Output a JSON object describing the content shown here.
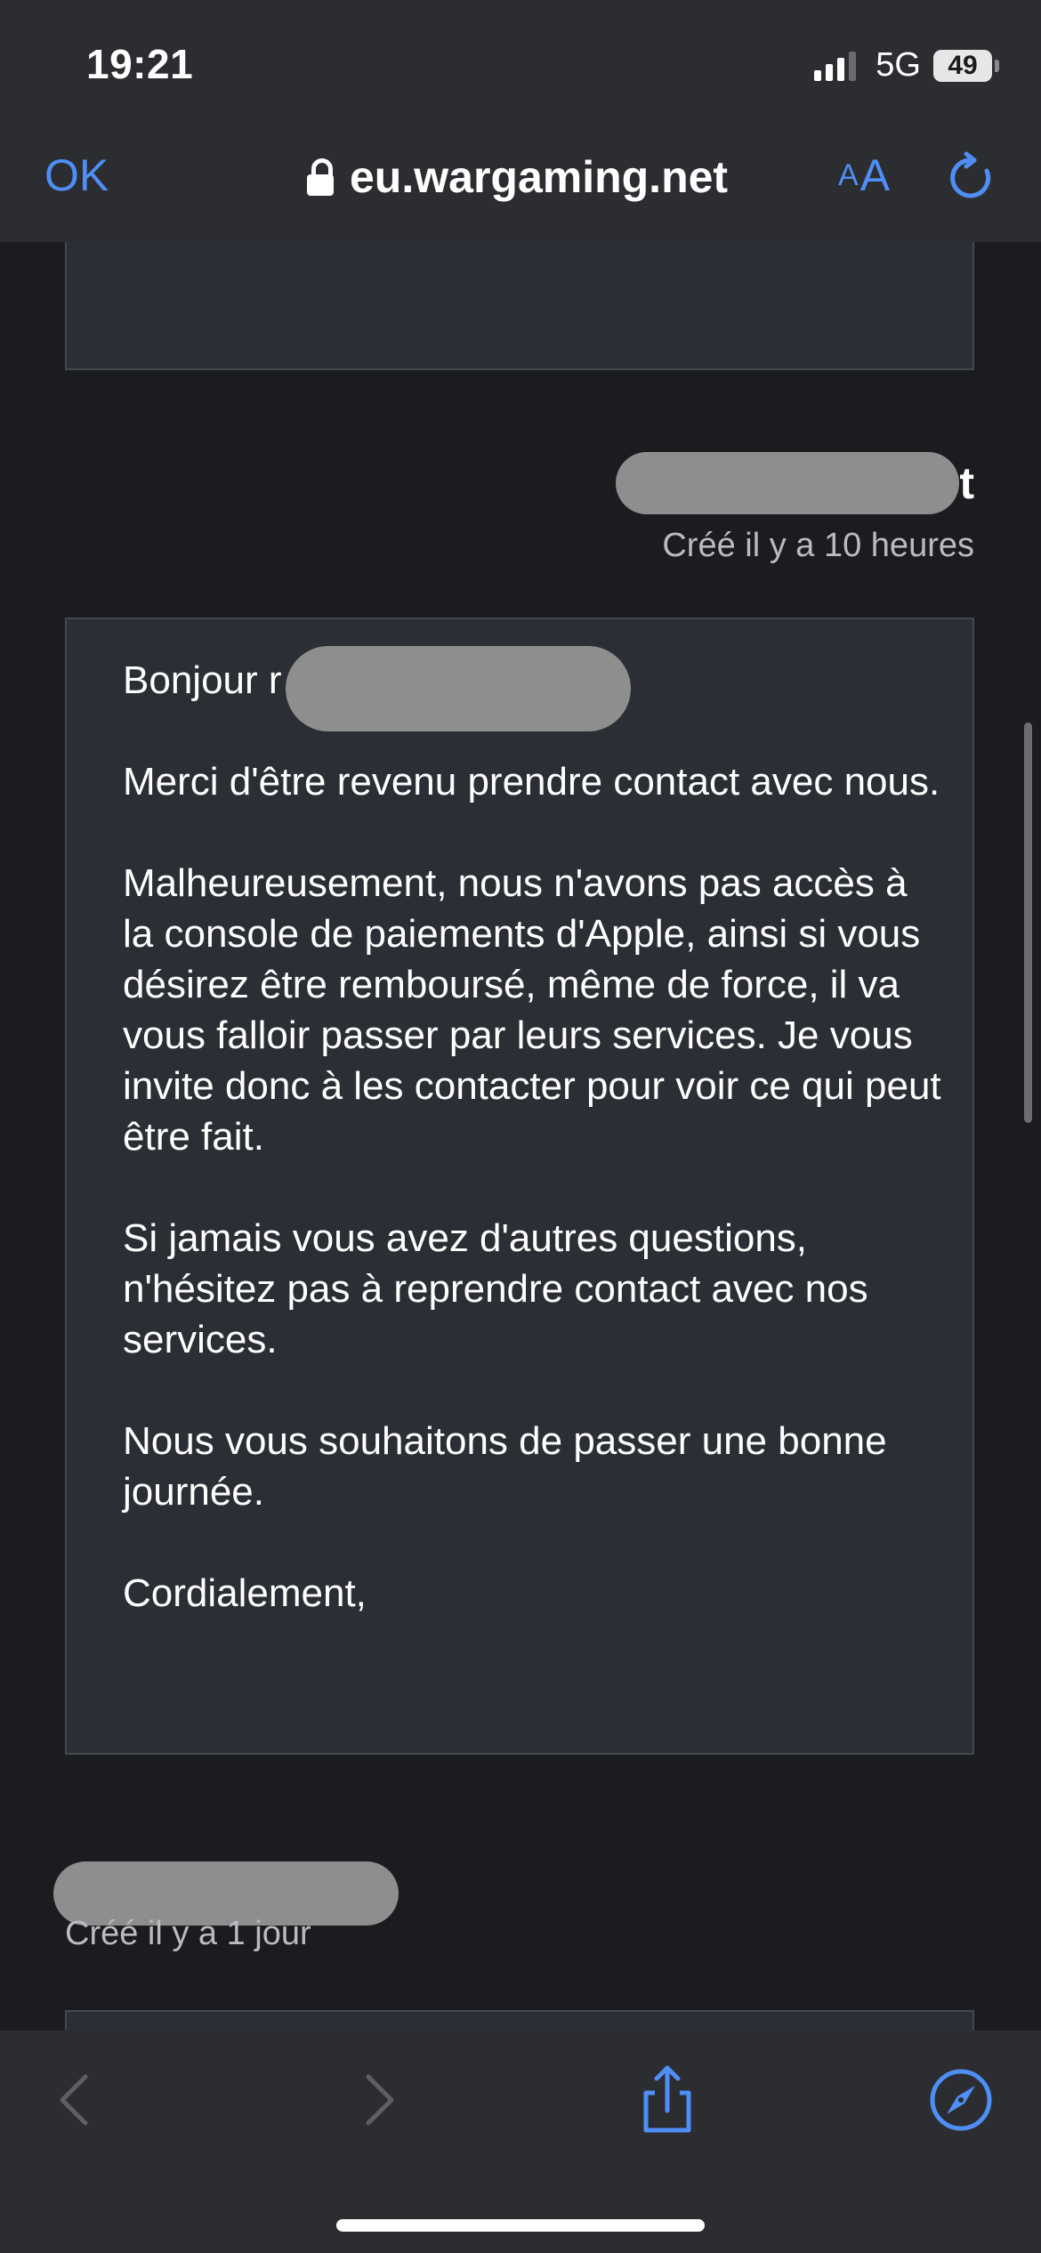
{
  "status_bar": {
    "time": "19:21",
    "network": "5G",
    "battery": "49",
    "icons": [
      "signal-icon",
      "battery-icon"
    ]
  },
  "browser": {
    "done_label": "OK",
    "domain": "eu.wargaming.net",
    "text_size_small": "A",
    "text_size_large": "A",
    "icons": [
      "lock-icon",
      "reload-icon"
    ],
    "accent_color": "#4f8ef5"
  },
  "thread": {
    "reply": {
      "author_visible_suffix": "t",
      "created": "Créé il y a 10 heures",
      "paragraphs": [
        "Bonjour r",
        "Merci d'être revenu prendre contact avec nous.",
        "Malheureusement, nous n'avons pas accès à la console de paiements d'Apple, ainsi si vous désirez être remboursé, même de force, il va vous falloir passer par leurs services. Je vous invite donc à les contacter pour voir ce qui peut être fait.",
        "Si jamais vous avez d'autres questions, n'hésitez pas à reprendre contact avec nos services.",
        "Nous vous souhaitons de passer une bonne journée.",
        "Cordialement,"
      ]
    },
    "previous": {
      "created": "Créé il y a 1 jour"
    }
  },
  "toolbar": {
    "icons": [
      "back-icon",
      "forward-icon",
      "share-icon",
      "compass-icon"
    ]
  }
}
